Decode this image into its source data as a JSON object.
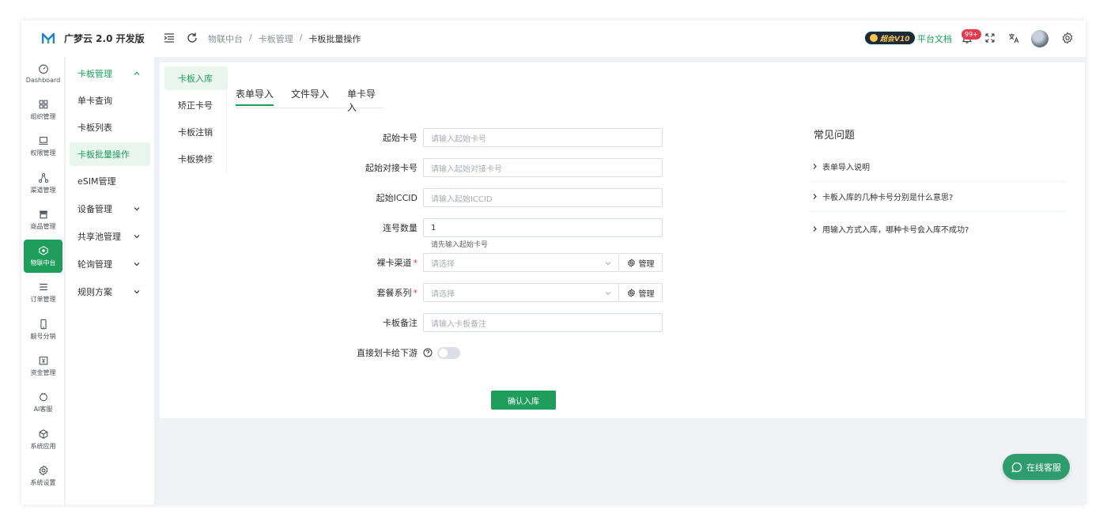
{
  "app": {
    "title": "广梦云 2.0 开发版"
  },
  "breadcrumb": [
    "物联中台",
    "卡板管理",
    "卡板批量操作"
  ],
  "header": {
    "vip_label": "超会V10",
    "doc_link": "平台文档",
    "notice_count": "99+"
  },
  "rail": [
    {
      "label": "Dashboard",
      "icon": "gauge-icon"
    },
    {
      "label": "组织管理",
      "icon": "grid-icon"
    },
    {
      "label": "权限管理",
      "icon": "laptop-icon"
    },
    {
      "label": "渠道管理",
      "icon": "network-icon"
    },
    {
      "label": "商品管理",
      "icon": "store-icon"
    },
    {
      "label": "物联中台",
      "icon": "iot-icon",
      "active": true
    },
    {
      "label": "订单管理",
      "icon": "list-icon"
    },
    {
      "label": "靓号分销",
      "icon": "phone-icon"
    },
    {
      "label": "资金管理",
      "icon": "wallet-icon"
    },
    {
      "label": "AI客服",
      "icon": "chat-icon"
    },
    {
      "label": "系统应用",
      "icon": "cube-icon"
    },
    {
      "label": "系统设置",
      "icon": "gear-icon"
    }
  ],
  "submenu": {
    "group": "卡板管理",
    "items": [
      "单卡查询",
      "卡板列表",
      "卡板批量操作",
      "eSIM管理"
    ],
    "groups": [
      "设备管理",
      "共享池管理",
      "轮询管理",
      "规则方案"
    ]
  },
  "tabnav": [
    "卡板入库",
    "矫正卡号",
    "卡板注销",
    "卡板换修"
  ],
  "toptabs": [
    "表单导入",
    "文件导入",
    "单卡导入"
  ],
  "form": {
    "start_card": {
      "label": "起始卡号",
      "placeholder": "请输入起始卡号"
    },
    "start_dock": {
      "label": "起始对接卡号",
      "placeholder": "请输入起始对接卡号"
    },
    "start_iccid": {
      "label": "起始ICCID",
      "placeholder": "请输入起始ICCID"
    },
    "count": {
      "label": "连号数量",
      "value": "1",
      "hint": "请先输入起始卡号"
    },
    "channel": {
      "label": "裸卡渠道",
      "placeholder": "请选择",
      "manage": "管理"
    },
    "package": {
      "label": "套餐系列",
      "placeholder": "请选择",
      "manage": "管理"
    },
    "remark": {
      "label": "卡板备注",
      "placeholder": "请输入卡板备注"
    },
    "assign": {
      "label": "直接划卡给下游"
    },
    "submit": "确认入库"
  },
  "faq": {
    "title": "常见问题",
    "items": [
      "表单导入说明",
      "卡板入库的几种卡号分别是什么意思?",
      "用输入方式入库，哪种卡号会入库不成功?"
    ]
  },
  "service": {
    "label": "在线客服"
  },
  "colors": {
    "primary": "#1f9d5b",
    "danger": "#e23a4f"
  }
}
